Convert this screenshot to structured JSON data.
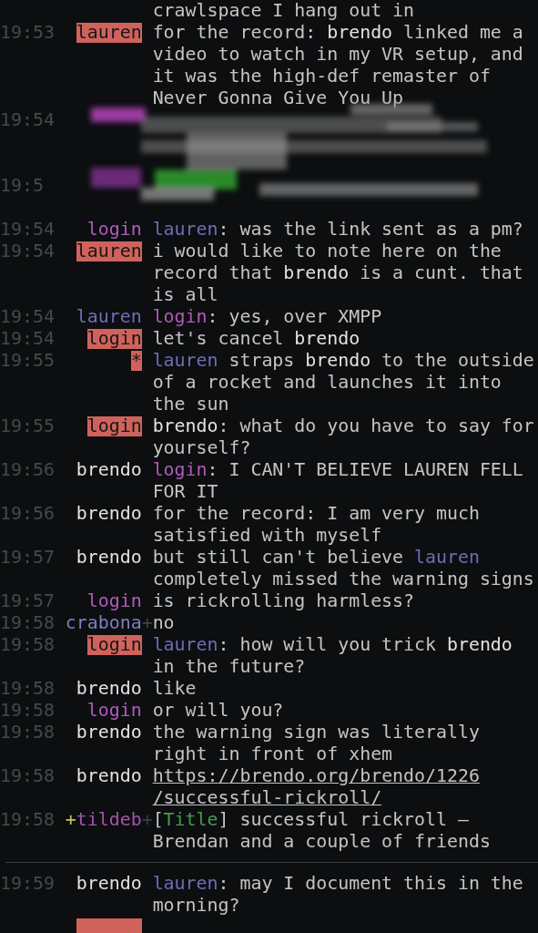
{
  "lines": [
    {
      "kind": "continuation",
      "parts": [
        {
          "kind": "text",
          "text": "crawlspace I hang out in"
        }
      ]
    },
    {
      "kind": "message",
      "time": "19:53",
      "nick": "lauren",
      "highlight": true,
      "parts": [
        {
          "kind": "text",
          "text": "for the record: "
        },
        {
          "kind": "nick",
          "text": "brendo",
          "color": "#e2e2e2"
        },
        {
          "kind": "text",
          "text": " linked me a video to watch in my VR setup, and it was the high-def remaster of Never Gonna Give You Up"
        }
      ]
    },
    {
      "kind": "redacted",
      "rows": [
        {
          "kind": "timed",
          "time": "19:54"
        },
        {
          "kind": "blank"
        },
        {
          "kind": "blank"
        },
        {
          "kind": "timed",
          "time": "19:5"
        },
        {
          "kind": "blank"
        }
      ]
    },
    {
      "kind": "message",
      "time": "19:54",
      "nick": "login",
      "color": "#b05cb8",
      "highlight": false,
      "parts": [
        {
          "kind": "nick",
          "text": "lauren",
          "color": "#6e6eb4"
        },
        {
          "kind": "text",
          "text": ": was the link sent as a pm?"
        }
      ]
    },
    {
      "kind": "message",
      "time": "19:54",
      "nick": "lauren",
      "highlight": true,
      "parts": [
        {
          "kind": "text",
          "text": "i would like to note here on the record that "
        },
        {
          "kind": "nick",
          "text": "brendo",
          "color": "#e2e2e2"
        },
        {
          "kind": "text",
          "text": " is a cunt. that is all"
        }
      ]
    },
    {
      "kind": "message",
      "time": "19:54",
      "nick": "lauren",
      "color": "#6e6eb4",
      "highlight": false,
      "parts": [
        {
          "kind": "nick",
          "text": "login",
          "color": "#b05cb8"
        },
        {
          "kind": "text",
          "text": ": yes, over XMPP"
        }
      ]
    },
    {
      "kind": "message",
      "time": "19:54",
      "nick": "login",
      "highlight": true,
      "parts": [
        {
          "kind": "text",
          "text": "let's cancel "
        },
        {
          "kind": "nick",
          "text": "brendo",
          "color": "#e2e2e2"
        }
      ]
    },
    {
      "kind": "message",
      "time": "19:55",
      "nick": "*",
      "highlight": true,
      "parts": [
        {
          "kind": "nick",
          "text": "lauren",
          "color": "#6e6eb4"
        },
        {
          "kind": "text",
          "text": " straps "
        },
        {
          "kind": "nick",
          "text": "brendo",
          "color": "#e2e2e2"
        },
        {
          "kind": "text",
          "text": " to the outside of a rocket and launches it into the sun"
        }
      ]
    },
    {
      "kind": "message",
      "time": "19:55",
      "nick": "login",
      "highlight": true,
      "parts": [
        {
          "kind": "nick",
          "text": "brendo",
          "color": "#e2e2e2"
        },
        {
          "kind": "text",
          "text": ": what do you have to say for yourself?"
        }
      ]
    },
    {
      "kind": "message",
      "time": "19:56",
      "nick": "brendo",
      "color": "#e2e2e2",
      "highlight": false,
      "parts": [
        {
          "kind": "nick",
          "text": "login",
          "color": "#b05cb8"
        },
        {
          "kind": "text",
          "text": ": I CAN'T BELIEVE LAUREN FELL FOR IT"
        }
      ]
    },
    {
      "kind": "message",
      "time": "19:56",
      "nick": "brendo",
      "color": "#e2e2e2",
      "highlight": false,
      "parts": [
        {
          "kind": "text",
          "text": "for the record: I am very much satisfied with myself"
        }
      ]
    },
    {
      "kind": "message",
      "time": "19:57",
      "nick": "brendo",
      "color": "#e2e2e2",
      "highlight": false,
      "parts": [
        {
          "kind": "text",
          "text": "but still can't believe "
        },
        {
          "kind": "nick",
          "text": "lauren",
          "color": "#6e6eb4"
        },
        {
          "kind": "text",
          "text": " completely missed the warning signs"
        }
      ]
    },
    {
      "kind": "message",
      "time": "19:57",
      "nick": "login",
      "color": "#b05cb8",
      "highlight": false,
      "parts": [
        {
          "kind": "text",
          "text": "is rickrolling harmless?"
        }
      ]
    },
    {
      "kind": "message",
      "time": "19:58",
      "nick": "crabona",
      "color": "#7e7ec4",
      "highlight": false,
      "more": "+",
      "parts": [
        {
          "kind": "text",
          "text": "no"
        }
      ]
    },
    {
      "kind": "message",
      "time": "19:58",
      "nick": "login",
      "highlight": true,
      "parts": [
        {
          "kind": "nick",
          "text": "lauren",
          "color": "#6e6eb4"
        },
        {
          "kind": "text",
          "text": ": how will you trick "
        },
        {
          "kind": "nick",
          "text": "brendo",
          "color": "#e2e2e2"
        },
        {
          "kind": "text",
          "text": " in the future?"
        }
      ]
    },
    {
      "kind": "message",
      "time": "19:58",
      "nick": "brendo",
      "color": "#e2e2e2",
      "highlight": false,
      "parts": [
        {
          "kind": "text",
          "text": "like"
        }
      ]
    },
    {
      "kind": "message",
      "time": "19:58",
      "nick": "login",
      "color": "#b05cb8",
      "highlight": false,
      "parts": [
        {
          "kind": "text",
          "text": "or will you?"
        }
      ]
    },
    {
      "kind": "message",
      "time": "19:58",
      "nick": "brendo",
      "color": "#e2e2e2",
      "highlight": false,
      "parts": [
        {
          "kind": "text",
          "text": "the warning sign was literally right in front of xhem"
        }
      ]
    },
    {
      "kind": "message",
      "time": "19:58",
      "nick": "brendo",
      "color": "#e2e2e2",
      "highlight": false,
      "parts": [
        {
          "kind": "link",
          "text": "https://brendo.org/brendo/1226/successful-rickroll/"
        }
      ]
    },
    {
      "kind": "message",
      "time": "19:58",
      "nick": "tildeb",
      "prefix": "+",
      "color": "#a452b0",
      "highlight": false,
      "more": "+",
      "parts": [
        {
          "kind": "text",
          "text": "["
        },
        {
          "kind": "tag",
          "text": "Title"
        },
        {
          "kind": "text",
          "text": "] successful rickroll – Brendan and a couple of friends"
        }
      ]
    },
    {
      "kind": "divider"
    },
    {
      "kind": "message",
      "time": "19:59",
      "nick": "brendo",
      "color": "#e2e2e2",
      "highlight": false,
      "parts": [
        {
          "kind": "nick",
          "text": "lauren",
          "color": "#6e6eb4"
        },
        {
          "kind": "text",
          "text": ": may I document this in the morning?"
        }
      ]
    },
    {
      "kind": "partial",
      "highlight": true
    }
  ]
}
